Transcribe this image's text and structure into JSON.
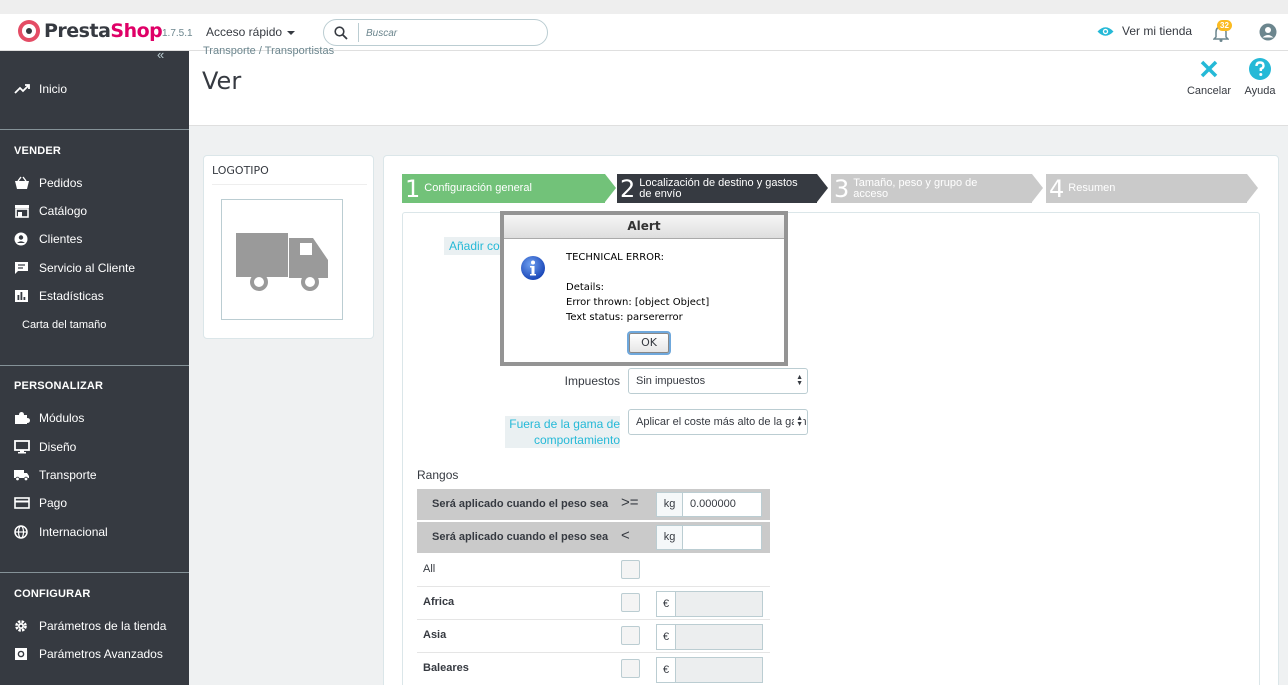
{
  "header": {
    "brand_presta": "Presta",
    "brand_shop": "Shop",
    "version": "1.7.5.1",
    "quick_access": "Acceso rápido",
    "search_placeholder": "Buscar",
    "view_store": "Ver mi tienda",
    "notifications_count": "32"
  },
  "sidebar": {
    "home": "Inicio",
    "sections": [
      {
        "title": "VENDER",
        "items": [
          "Pedidos",
          "Catálogo",
          "Clientes",
          "Servicio al Cliente",
          "Estadísticas"
        ],
        "sub": "Carta del tamaño"
      },
      {
        "title": "PERSONALIZAR",
        "items": [
          "Módulos",
          "Diseño",
          "Transporte",
          "Pago",
          "Internacional"
        ]
      },
      {
        "title": "CONFIGURAR",
        "items": [
          "Parámetros de la tienda",
          "Parámetros Avanzados"
        ]
      }
    ]
  },
  "toolbar": {
    "breadcrumb_1": "Transporte",
    "breadcrumb_sep": "/",
    "breadcrumb_2": "Transportistas",
    "title": "Ver",
    "cancel": "Cancelar",
    "help": "Ayuda"
  },
  "logo_panel": {
    "title": "LOGOTIPO"
  },
  "wizard": {
    "steps": [
      {
        "num": "1",
        "label": "Configuración general"
      },
      {
        "num": "2",
        "label_1": "Localización de destino y gastos",
        "label_2": "de envío"
      },
      {
        "num": "3",
        "label_1": "Tamaño, peso y grupo de",
        "label_2": "acceso"
      },
      {
        "num": "4",
        "label": "Resumen"
      }
    ]
  },
  "form": {
    "add_link": "Añadir co",
    "taxes_label": "Impuestos",
    "taxes_value": "Sin impuestos",
    "out_of_range_label_1": "Fuera de la gama de",
    "out_of_range_label_2": "comportamiento",
    "out_of_range_value": "Aplicar el coste más alto de la gama definida",
    "ranges_title": "Rangos",
    "range_rows": [
      {
        "text": "Será aplicado cuando el peso sea",
        "op": ">=",
        "unit": "kg",
        "value": "0.000000"
      },
      {
        "text": "Será aplicado cuando el peso sea",
        "op": "<",
        "unit": "kg",
        "value": ""
      }
    ],
    "zones": [
      {
        "name": "All",
        "bold": false,
        "currency": ""
      },
      {
        "name": "Africa",
        "bold": true,
        "currency": "€"
      },
      {
        "name": "Asia",
        "bold": true,
        "currency": "€"
      },
      {
        "name": "Baleares",
        "bold": true,
        "currency": "€"
      }
    ]
  },
  "alert": {
    "title": "Alert",
    "line1": "TECHNICAL ERROR:",
    "line2": "Details:",
    "line3": "Error thrown: [object Object]",
    "line4": "Text status: parsererror",
    "ok": "OK"
  },
  "colors": {
    "accent": "#25b9d7",
    "sidebar": "#363a41",
    "step_active": "#72c279",
    "step_current": "#363a41",
    "step_inactive": "#cacaca"
  }
}
